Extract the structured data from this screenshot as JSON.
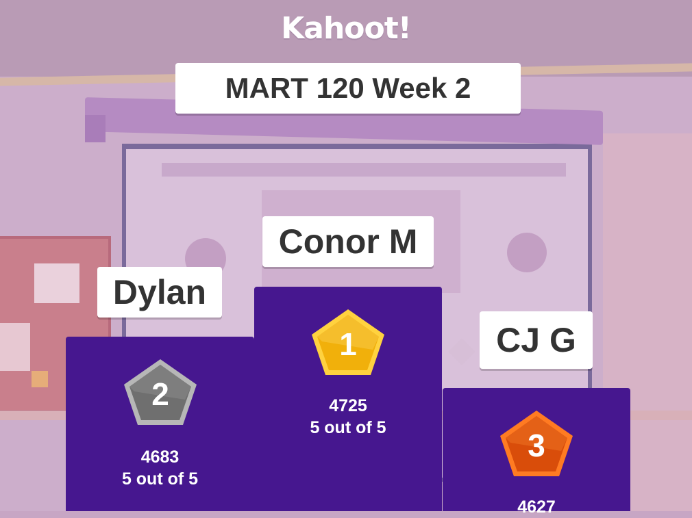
{
  "brand": {
    "logo_text": "Kahoot!"
  },
  "quiz": {
    "title": "MART 120 Week 2"
  },
  "podium": [
    {
      "rank": "1",
      "name": "Conor M",
      "points": "4725",
      "correct": "5 out of 5",
      "medal": "gold-pentagon-icon",
      "color": "#f2b705"
    },
    {
      "rank": "2",
      "name": "Dylan",
      "points": "4683",
      "correct": "5 out of 5",
      "medal": "silver-pentagon-icon",
      "color": "#7a7a7a"
    },
    {
      "rank": "3",
      "name": "CJ G",
      "points": "4627",
      "correct": "",
      "medal": "bronze-pentagon-icon",
      "color": "#e4580f"
    }
  ],
  "colors": {
    "podium": "#46178f",
    "background": "#c7a6c4"
  }
}
